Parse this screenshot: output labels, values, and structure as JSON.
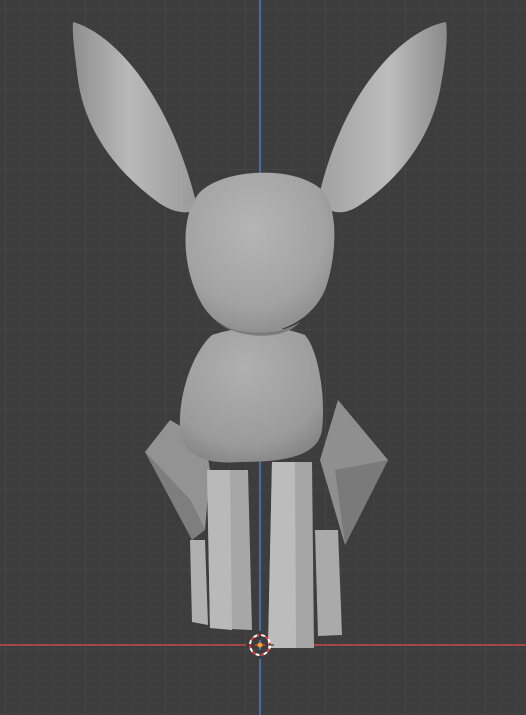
{
  "viewport": {
    "view": "front-orthographic",
    "background_color": "#3d3d3d",
    "grid_minor_color": "#454545",
    "grid_major_color": "#4d4d4d",
    "x_axis_color": "#c84b4b",
    "z_axis_color": "#4a7bbf",
    "model_base_color": "#9e9e9e",
    "model_light_color": "#b8b8b8",
    "model_shadow_color": "#6f6f6f",
    "cursor_color_a": "#e04040",
    "cursor_color_b": "#ffffff",
    "origin_point_color": "#f0a030"
  },
  "scene": {
    "object_name": "rabbit",
    "parts": [
      "left-ear",
      "right-ear",
      "head",
      "body",
      "left-thigh",
      "right-thigh",
      "front-left-leg",
      "front-right-leg"
    ]
  },
  "icons": {
    "cursor": "3d-cursor-icon",
    "origin": "object-origin-icon"
  }
}
